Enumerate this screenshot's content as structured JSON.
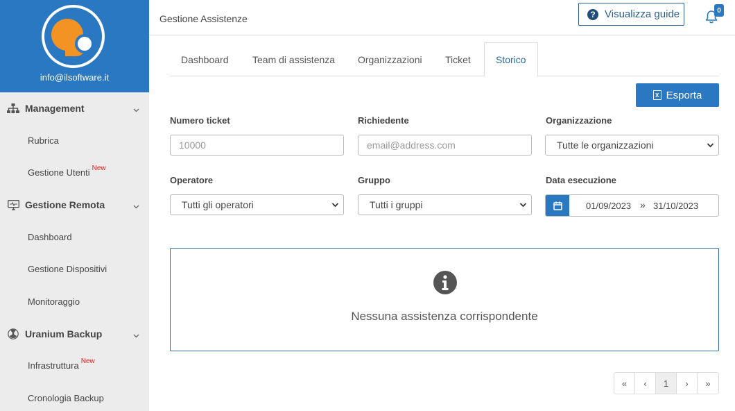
{
  "sidebar": {
    "email": "info@ilsoftware.it",
    "sections": [
      {
        "label": "Management",
        "icon": "sitemap-icon",
        "items": [
          {
            "label": "Rubrica",
            "badge": ""
          },
          {
            "label": "Gestione Utenti",
            "badge": "New"
          }
        ]
      },
      {
        "label": "Gestione Remota",
        "icon": "desktop-icon",
        "items": [
          {
            "label": "Dashboard",
            "badge": ""
          },
          {
            "label": "Gestione Dispositivi",
            "badge": ""
          },
          {
            "label": "Monitoraggio",
            "badge": ""
          }
        ]
      },
      {
        "label": "Uranium Backup",
        "icon": "radiation-icon",
        "items": [
          {
            "label": "Infrastruttura",
            "badge": "New"
          },
          {
            "label": "Cronologia Backup",
            "badge": ""
          }
        ]
      }
    ]
  },
  "header": {
    "title": "Gestione Assistenze",
    "guide_button": "Visualizza guide",
    "notification_count": "0"
  },
  "tabs": [
    {
      "label": "Dashboard"
    },
    {
      "label": "Team di assistenza"
    },
    {
      "label": "Organizzazioni"
    },
    {
      "label": "Ticket"
    },
    {
      "label": "Storico"
    }
  ],
  "active_tab": "Storico",
  "toolbar": {
    "export_label": "Esporta"
  },
  "form": {
    "ticket_number": {
      "label": "Numero ticket",
      "placeholder": "10000"
    },
    "requester": {
      "label": "Richiedente",
      "placeholder": "email@address.com"
    },
    "organization": {
      "label": "Organizzazione",
      "value": "Tutte le organizzazioni"
    },
    "operator": {
      "label": "Operatore",
      "value": "Tutti gli operatori"
    },
    "group": {
      "label": "Gruppo",
      "value": "Tutti i gruppi"
    },
    "execution_date": {
      "label": "Data esecuzione",
      "from": "01/09/2023",
      "separator": "»",
      "to": "31/10/2023"
    }
  },
  "empty_state": {
    "message": "Nessuna assistenza corrispondente"
  },
  "pagination": {
    "first": "«",
    "prev": "‹",
    "current_page": "1",
    "next": "›",
    "last": "»"
  },
  "colors": {
    "brand": "#2b78c2",
    "accent_orange": "#f39323",
    "badge_new": "#e02020"
  }
}
